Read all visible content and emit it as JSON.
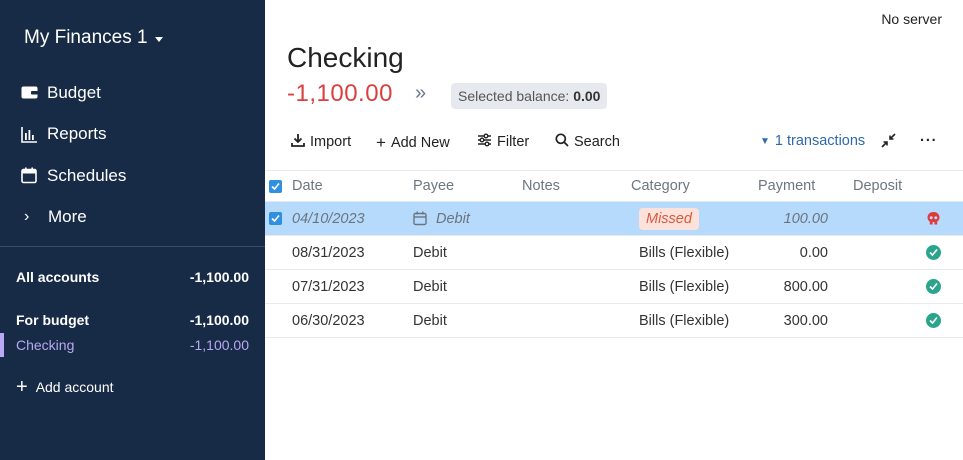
{
  "sidebar": {
    "budget_name": "My Finances 1",
    "nav": [
      {
        "label": "Budget",
        "icon": "wallet-icon"
      },
      {
        "label": "Reports",
        "icon": "bar-chart-icon"
      },
      {
        "label": "Schedules",
        "icon": "calendar-icon"
      },
      {
        "label": "More",
        "icon": "chevron-right-icon"
      }
    ],
    "all_accounts": {
      "label": "All accounts",
      "amount": "-1,100.00"
    },
    "for_budget": {
      "label": "For budget",
      "amount": "-1,100.00"
    },
    "checking": {
      "label": "Checking",
      "amount": "-1,100.00"
    },
    "add_account": "Add account"
  },
  "header": {
    "server_status": "No server",
    "title": "Checking",
    "balance": "-1,100.00",
    "selected_balance_label": "Selected balance:",
    "selected_balance_value": "0.00"
  },
  "toolbar": {
    "import": "Import",
    "add_new": "Add New",
    "filter": "Filter",
    "search": "Search",
    "transactions": "1 transactions"
  },
  "table": {
    "headers": {
      "date": "Date",
      "payee": "Payee",
      "notes": "Notes",
      "category": "Category",
      "payment": "Payment",
      "deposit": "Deposit"
    },
    "rows": [
      {
        "date": "04/10/2023",
        "payee": "Debit",
        "notes": "",
        "category": "Missed",
        "payment": "100.00",
        "deposit": "",
        "status": "missed"
      },
      {
        "date": "08/31/2023",
        "payee": "Debit",
        "notes": "",
        "category": "Bills (Flexible)",
        "payment": "0.00",
        "deposit": "",
        "status": "cleared"
      },
      {
        "date": "07/31/2023",
        "payee": "Debit",
        "notes": "",
        "category": "Bills (Flexible)",
        "payment": "800.00",
        "deposit": "",
        "status": "cleared"
      },
      {
        "date": "06/30/2023",
        "payee": "Debit",
        "notes": "",
        "category": "Bills (Flexible)",
        "payment": "300.00",
        "deposit": "",
        "status": "cleared"
      }
    ]
  },
  "colors": {
    "sidebar": "#172b46",
    "negative": "#d94040",
    "accent": "#2f6aa7",
    "selected_row": "#b6dafc",
    "cleared": "#2aa58b",
    "missed": "#d85a3c"
  }
}
